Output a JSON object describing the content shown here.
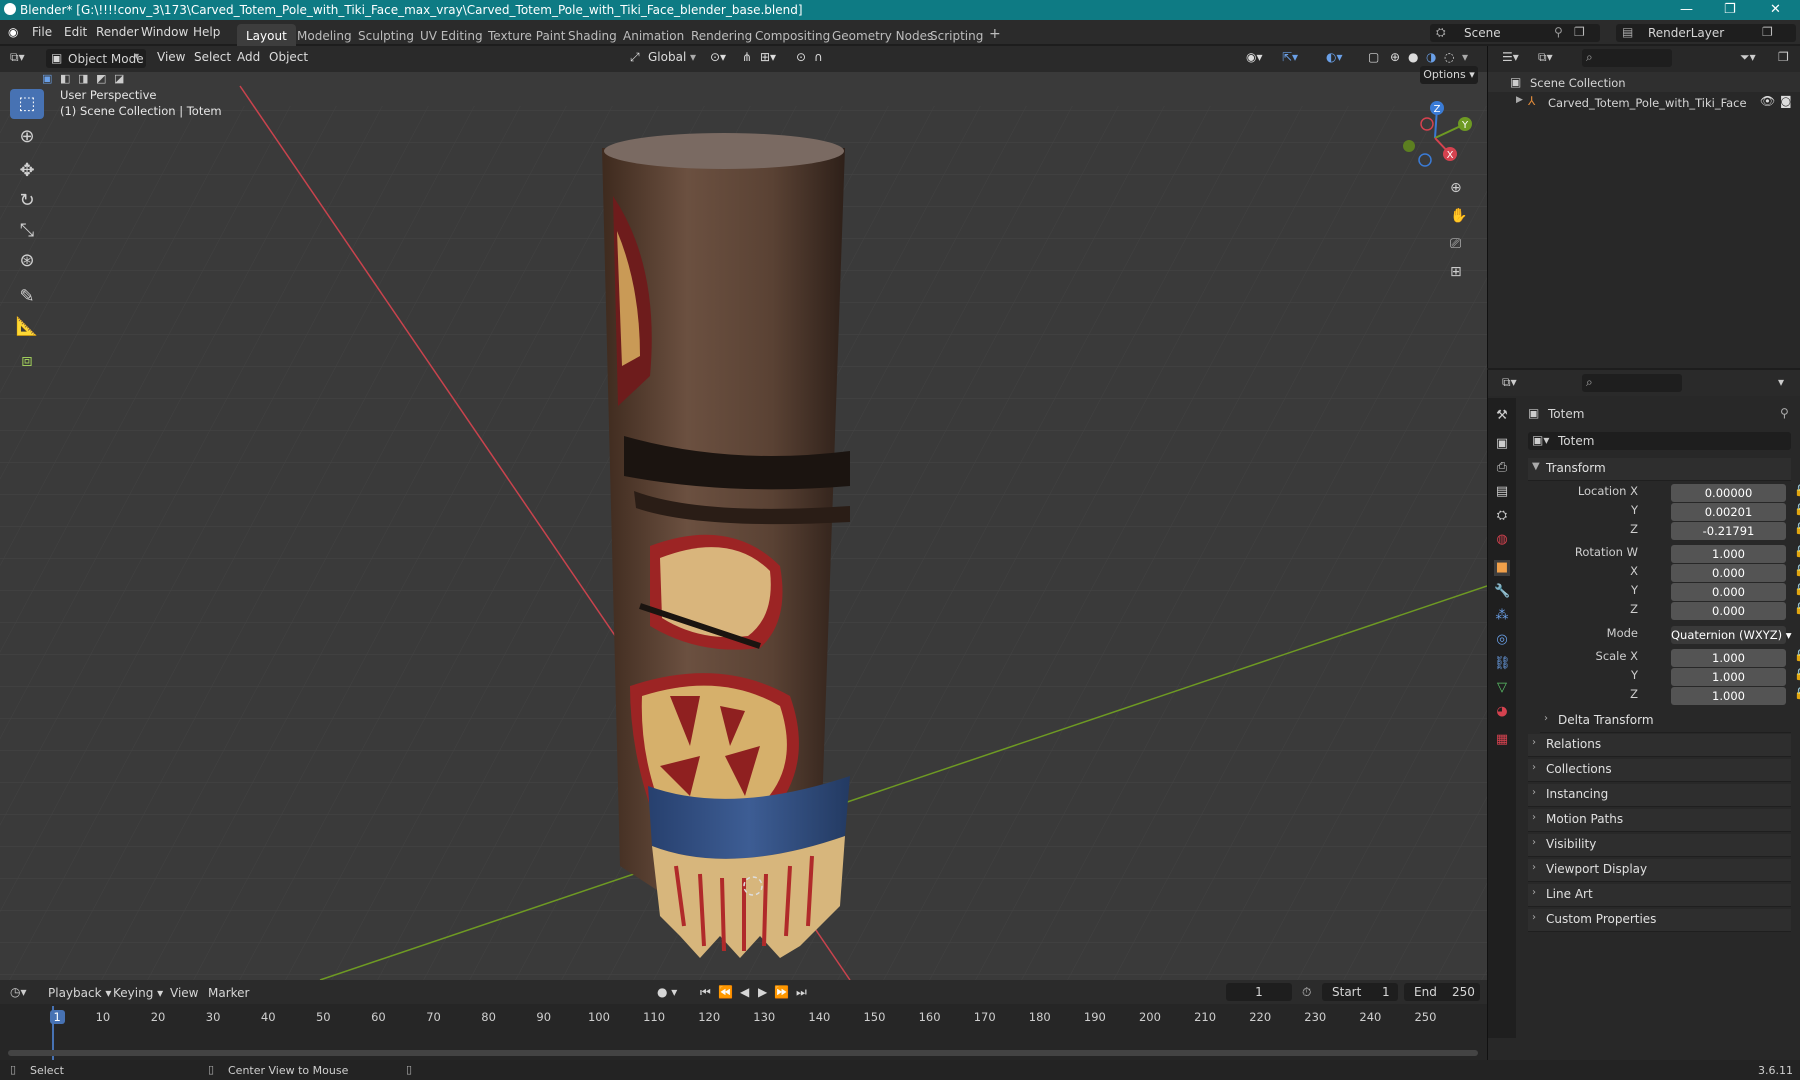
{
  "window": {
    "title": "Blender* [G:\\!!!!conv_3\\173\\Carved_Totem_Pole_with_Tiki_Face_max_vray\\Carved_Totem_Pole_with_Tiki_Face_blender_base.blend]"
  },
  "menu": [
    "File",
    "Edit",
    "Render",
    "Window",
    "Help"
  ],
  "workspaces": [
    "Layout",
    "Modeling",
    "Sculpting",
    "UV Editing",
    "Texture Paint",
    "Shading",
    "Animation",
    "Rendering",
    "Compositing",
    "Geometry Nodes",
    "Scripting"
  ],
  "scene": {
    "name": "Scene",
    "layer": "RenderLayer"
  },
  "viewport": {
    "mode": "Object Mode",
    "menus": [
      "View",
      "Select",
      "Add",
      "Object"
    ],
    "orientation": "Global",
    "options": "Options",
    "overlay_line1": "User Perspective",
    "overlay_line2": "(1) Scene Collection | Totem",
    "axes": {
      "x": "X",
      "y": "Y",
      "z": "Z"
    }
  },
  "outliner": {
    "root": "Scene Collection",
    "items": [
      {
        "label": "Carved_Totem_Pole_with_Tiki_Face"
      }
    ]
  },
  "properties": {
    "object_name": "Totem",
    "object_field": "Totem",
    "transform_label": "Transform",
    "location": {
      "label": "Location X",
      "x": "0.00000",
      "y": "0.00201",
      "z": "-0.21791"
    },
    "rotation": {
      "label": "Rotation W",
      "w": "1.000",
      "x": "0.000",
      "y": "0.000",
      "z": "0.000"
    },
    "mode_label": "Mode",
    "mode": "Quaternion (WXYZ)",
    "scale": {
      "label": "Scale X",
      "x": "1.000",
      "y": "1.000",
      "z": "1.000"
    },
    "axis_labels": {
      "y": "Y",
      "z": "Z",
      "x": "X"
    },
    "delta": "Delta Transform",
    "panels": [
      "Relations",
      "Collections",
      "Instancing",
      "Motion Paths",
      "Visibility",
      "Viewport Display",
      "Line Art",
      "Custom Properties"
    ]
  },
  "timeline": {
    "menus": [
      "Playback",
      "Keying",
      "View",
      "Marker"
    ],
    "current_frame": "1",
    "start_label": "Start",
    "start": "1",
    "end_label": "End",
    "end": "250",
    "ticks": [
      "1",
      "10",
      "20",
      "30",
      "40",
      "50",
      "60",
      "70",
      "80",
      "90",
      "100",
      "110",
      "120",
      "130",
      "140",
      "150",
      "160",
      "170",
      "180",
      "190",
      "200",
      "210",
      "220",
      "230",
      "240",
      "250"
    ]
  },
  "status": {
    "select": "Select",
    "center": "Center View to Mouse",
    "version": "3.6.11"
  },
  "colors": {
    "accent": "#4772b3",
    "titlebar": "#0e7b84",
    "axis_x": "#d5424f",
    "axis_y": "#6a9a1e",
    "axis_z": "#3a7bd5"
  }
}
